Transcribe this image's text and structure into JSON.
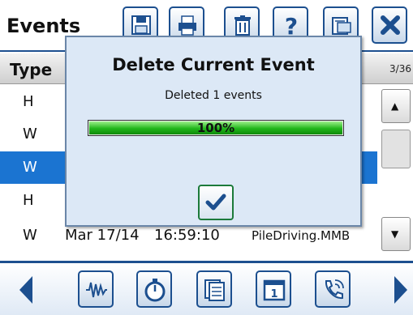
{
  "app": {
    "title": "Events",
    "toolbar_icons": [
      "save-icon",
      "print-icon",
      "trash-icon",
      "help-icon",
      "export-icon",
      "close-icon"
    ]
  },
  "table": {
    "header_type": "Type",
    "page_indicator": "3/36",
    "rows": [
      {
        "type": "H",
        "selected": false
      },
      {
        "type": "W",
        "selected": false
      },
      {
        "type": "W",
        "selected": true
      },
      {
        "type": "H",
        "selected": false
      },
      {
        "type": "W",
        "date": "Mar 17/14",
        "time": "16:59:10",
        "file": "PileDriving.MMB",
        "selected": false
      }
    ]
  },
  "nav": {
    "icons": [
      "waveform-icon",
      "stopwatch-icon",
      "documents-icon",
      "calendar-icon",
      "phone-icon"
    ]
  },
  "dialog": {
    "title": "Delete Current Event",
    "message": "Deleted 1 events",
    "progress_text": "100%",
    "progress_value": 1.0,
    "ok_icon": "checkmark-icon"
  },
  "colors": {
    "accent": "#1c4f8f",
    "selected_row": "#1b74d1",
    "dialog_bg": "#dce8f6",
    "progress_green": "#1fb51a"
  }
}
